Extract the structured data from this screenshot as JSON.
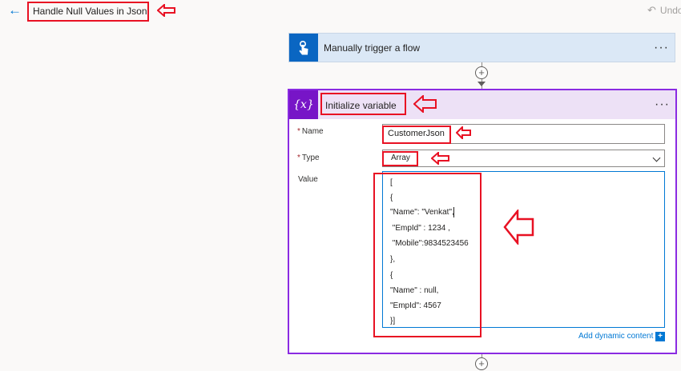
{
  "header": {
    "back_icon": "arrow-left-icon",
    "flow_title": "Handle Null Values in Json",
    "undo_label": "Undo",
    "undo_icon": "undo-icon"
  },
  "trigger_card": {
    "title": "Manually trigger a flow",
    "icon": "touch-hand-icon",
    "more_label": "···"
  },
  "variable_card": {
    "title": "Initialize variable",
    "icon_label": "{x}",
    "more_label": "···",
    "fields": {
      "name_label": "Name",
      "name_value": "CustomerJson",
      "type_label": "Type",
      "type_value": "Array",
      "value_label": "Value",
      "required_marker": "*"
    },
    "value_lines": [
      "[",
      "{",
      "\"Name\": \"Venkat\",",
      " \"EmpId\" : 1234 ,",
      " \"Mobile\":9834523456",
      "},",
      "{",
      "\"Name\" : null,",
      "\"EmpId\": 4567",
      "}]"
    ],
    "add_dynamic_content": "Add dynamic content",
    "add_dynamic_icon": "+"
  },
  "connectors": {
    "plus_label": "+"
  },
  "colors": {
    "annotation": "#e81123",
    "trigger_header": "#dbe8f6",
    "trigger_icon_bg": "#0a66c2",
    "variable_border": "#8a2be2",
    "variable_header": "#ede1f6",
    "variable_icon_bg": "#7715c7",
    "link": "#0078d4"
  }
}
